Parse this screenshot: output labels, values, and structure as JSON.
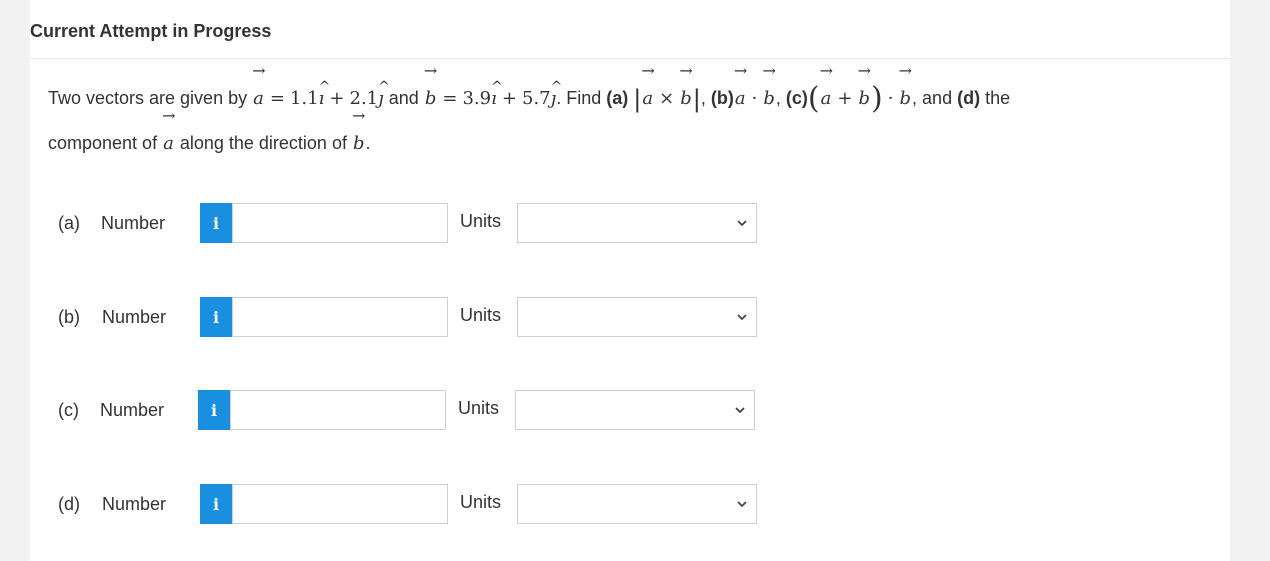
{
  "header": {
    "title": "Current Attempt in Progress"
  },
  "question": {
    "t_intro": "Two vectors are given by",
    "a_sym": "a",
    "eq": "=",
    "a_expr1": "1.1",
    "i_sym": "ı",
    "plus": "+",
    "a_expr2": "2.1",
    "j_sym": "ȷ",
    "t_and": "and",
    "b_sym": "b",
    "b_expr1": "3.9",
    "b_expr2": "5.7",
    "t_find": ". Find",
    "pa": "(a)",
    "cross": "×",
    "pb": "(b)",
    "dot": "·",
    "pc": "(c)",
    "t_and_d": ", and",
    "pd": "(d)",
    "t_the": "the",
    "line2_start": "component of",
    "line2_mid": "along the direction of",
    "period": "."
  },
  "parts": [
    {
      "label": "(a)",
      "kind": "Number",
      "units_label": "Units",
      "value": "",
      "units_value": ""
    },
    {
      "label": "(b)",
      "kind": "Number",
      "units_label": "Units",
      "value": "",
      "units_value": ""
    },
    {
      "label": "(c)",
      "kind": "Number",
      "units_label": "Units",
      "value": "",
      "units_value": ""
    },
    {
      "label": "(d)",
      "kind": "Number",
      "units_label": "Units",
      "value": "",
      "units_value": ""
    }
  ],
  "icons": {
    "info": "i",
    "info_icon": "info-icon",
    "dropdown_icon": "chevron-down-icon"
  },
  "colors": {
    "info_button": "#1a8fe0",
    "background": "#f2f2f2",
    "card": "#ffffff"
  }
}
